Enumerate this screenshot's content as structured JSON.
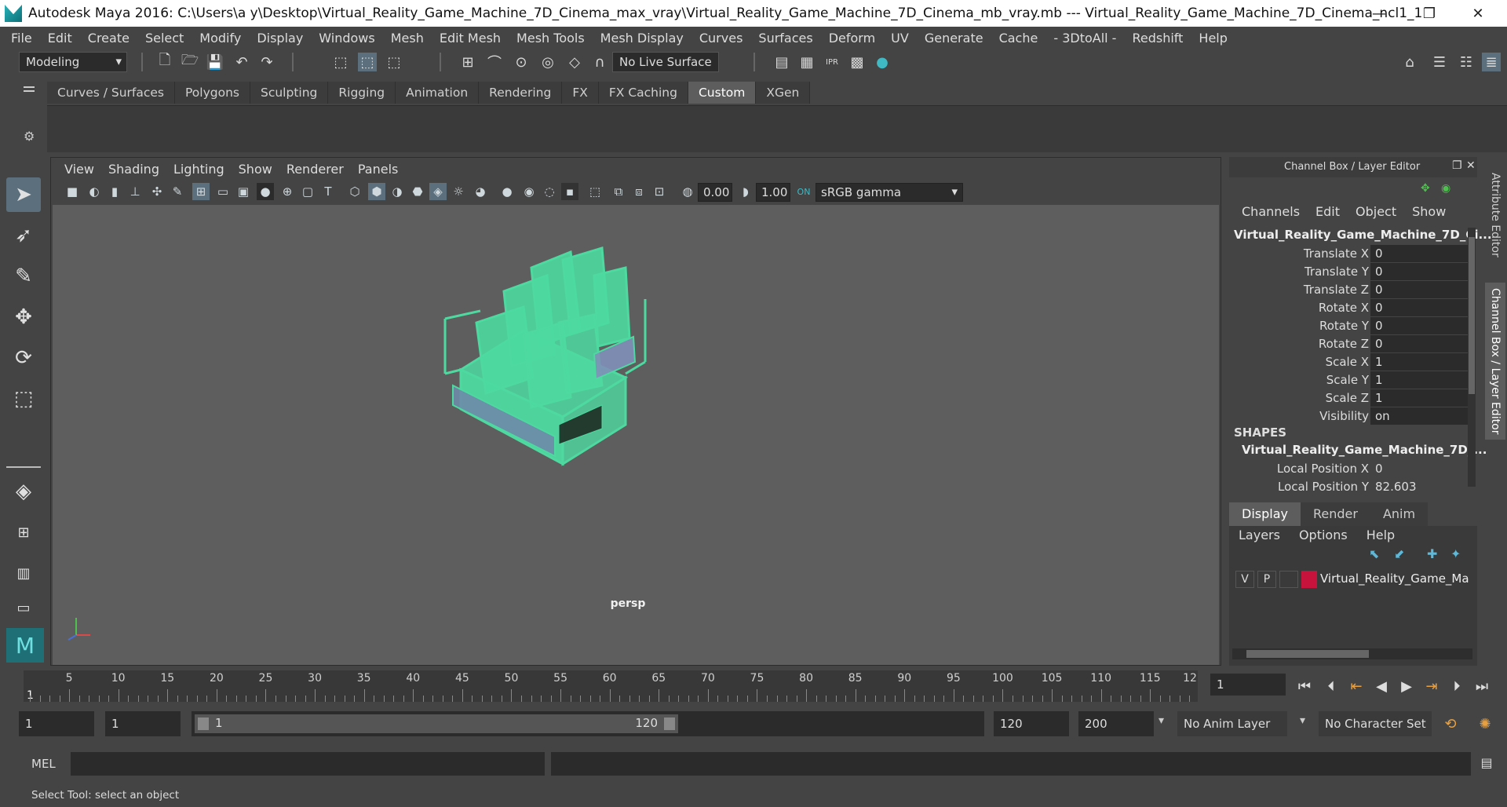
{
  "window": {
    "title": "Autodesk Maya 2016: C:\\Users\\a y\\Desktop\\Virtual_Reality_Game_Machine_7D_Cinema_max_vray\\Virtual_Reality_Game_Machine_7D_Cinema_mb_vray.mb  ---  Virtual_Reality_Game_Machine_7D_Cinema_ncl1_1",
    "minimize": "—",
    "maximize": "❐",
    "close": "✕"
  },
  "menubar": [
    "File",
    "Edit",
    "Create",
    "Select",
    "Modify",
    "Display",
    "Windows",
    "Mesh",
    "Edit Mesh",
    "Mesh Tools",
    "Mesh Display",
    "Curves",
    "Surfaces",
    "Deform",
    "UV",
    "Generate",
    "Cache",
    "- 3DtoAll -",
    "Redshift",
    "Help"
  ],
  "statusline": {
    "mode": "Modeling",
    "live_surface": "No Live Surface"
  },
  "shelf": {
    "tabs": [
      "Curves / Surfaces",
      "Polygons",
      "Sculpting",
      "Rigging",
      "Animation",
      "Rendering",
      "FX",
      "FX Caching",
      "Custom",
      "XGen"
    ],
    "active": "Custom"
  },
  "viewport": {
    "menu": [
      "View",
      "Shading",
      "Lighting",
      "Show",
      "Renderer",
      "Panels"
    ],
    "exposure": "0.00",
    "gamma": "1.00",
    "color_space": "sRGB gamma",
    "camera": "persp",
    "mesh_color": "#4dd9a0"
  },
  "channel_box": {
    "title": "Channel Box / Layer Editor",
    "menu": [
      "Channels",
      "Edit",
      "Object",
      "Show"
    ],
    "object_name": "Virtual_Reality_Game_Machine_7D_Ci...",
    "attributes": [
      {
        "label": "Translate X",
        "value": "0"
      },
      {
        "label": "Translate Y",
        "value": "0"
      },
      {
        "label": "Translate Z",
        "value": "0"
      },
      {
        "label": "Rotate X",
        "value": "0"
      },
      {
        "label": "Rotate Y",
        "value": "0"
      },
      {
        "label": "Rotate Z",
        "value": "0"
      },
      {
        "label": "Scale X",
        "value": "1"
      },
      {
        "label": "Scale Y",
        "value": "1"
      },
      {
        "label": "Scale Z",
        "value": "1"
      },
      {
        "label": "Visibility",
        "value": "on"
      }
    ],
    "shapes_header": "SHAPES",
    "shape_name": "Virtual_Reality_Game_Machine_7D_...",
    "shape_attributes": [
      {
        "label": "Local Position X",
        "value": "0"
      },
      {
        "label": "Local Position Y",
        "value": "82.603"
      }
    ],
    "side_tabs": [
      "Attribute Editor",
      "Channel Box / Layer Editor"
    ]
  },
  "layer_editor": {
    "tabs": [
      "Display",
      "Render",
      "Anim"
    ],
    "active_tab": "Display",
    "menu": [
      "Layers",
      "Options",
      "Help"
    ],
    "layer": {
      "v": "V",
      "p": "P",
      "color": "#c8143c",
      "name": "Virtual_Reality_Game_Ma"
    }
  },
  "timeslider": {
    "ticks": [
      "5",
      "10",
      "15",
      "20",
      "25",
      "30",
      "35",
      "40",
      "45",
      "50",
      "55",
      "60",
      "65",
      "70",
      "75",
      "80",
      "85",
      "90",
      "95",
      "100",
      "105",
      "110",
      "115",
      "12"
    ],
    "start_marker": "1",
    "current_frame": "1"
  },
  "range": {
    "start": "1",
    "playback_start": "1",
    "range_start_label": "1",
    "range_end_label": "120",
    "playback_end": "120",
    "end": "200",
    "anim_layer": "No Anim Layer",
    "character_set": "No Character Set"
  },
  "cmdline": {
    "label": "MEL"
  },
  "helpline": {
    "text": "Select Tool: select an object"
  }
}
